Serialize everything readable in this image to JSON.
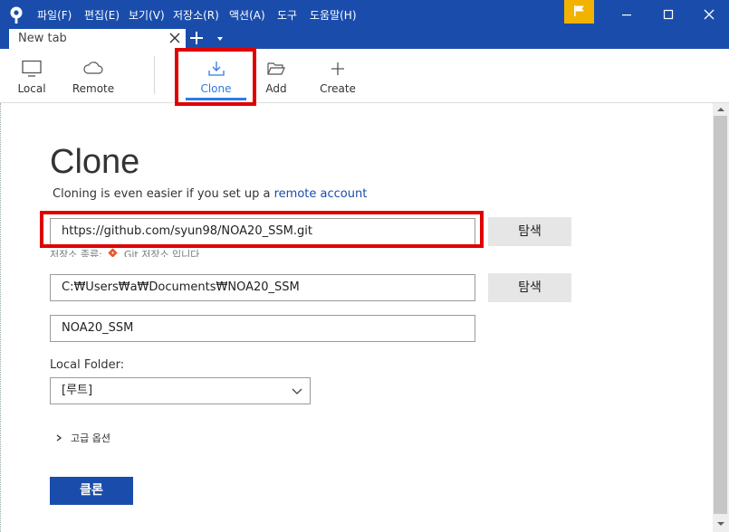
{
  "menubar": {
    "items": [
      "파일(F)",
      "편집(E)",
      "보기(V)",
      "저장소(R)",
      "액션(A)",
      "도구",
      "도움말(H)"
    ]
  },
  "tab": {
    "label": "New tab"
  },
  "toolbar": {
    "local": "Local",
    "remote": "Remote",
    "clone": "Clone",
    "add": "Add",
    "create": "Create"
  },
  "page": {
    "title": "Clone",
    "subtitle_prefix": "Cloning is even easier if you set up a ",
    "subtitle_link": "remote account"
  },
  "form": {
    "source_url": "https://github.com/syun98/NOA20_SSM.git",
    "browse_label": "탐색",
    "repo_type_label": "저장소 종류:",
    "repo_type_value": "Git 저장소 입니다",
    "destination_path": "C:₩Users₩a₩Documents₩NOA20_SSM",
    "name": "NOA20_SSM",
    "local_folder_label": "Local Folder:",
    "local_folder_value": "[루트]",
    "advanced_label": "고급 옵션",
    "clone_button": "클론"
  },
  "colors": {
    "accent": "#1a4dab",
    "flag": "#f2b200",
    "highlight": "#e00000",
    "clone_tab_active": "#2c7be5"
  }
}
